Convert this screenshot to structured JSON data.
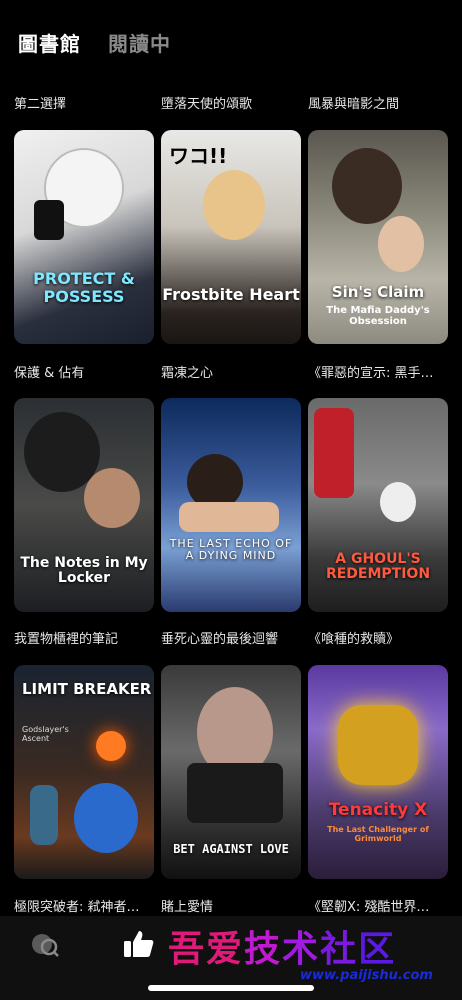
{
  "tabs": {
    "library": "圖書館",
    "reading": "閱讀中"
  },
  "row_labels": [
    "第二選擇",
    "墮落天使的頌歌",
    "風暴與暗影之間"
  ],
  "books": [
    {
      "cover_title": "PROTECT & POSSESS",
      "cover_sub": "",
      "caption": "保護 & 佔有"
    },
    {
      "cover_title": "Frostbite Heart",
      "cover_sub": "",
      "caption": "霜凍之心"
    },
    {
      "cover_title": "Sin's Claim",
      "cover_sub": "The Mafia Daddy's Obsession",
      "caption": "《罪惡的宣示: 黑手…"
    },
    {
      "cover_title": "The Notes in My Locker",
      "cover_sub": "",
      "caption": "我置物櫃裡的筆記"
    },
    {
      "cover_title": "THE LAST ECHO OF A DYING MIND",
      "cover_sub": "",
      "caption": "垂死心靈的最後迴響"
    },
    {
      "cover_title": "A GHOUL'S REDEMPTION",
      "cover_sub": "",
      "caption": "《喰種的救贖》"
    },
    {
      "cover_title": "LIMIT BREAKER",
      "cover_sub": "Godslayer's Ascent",
      "caption": "極限突破者: 弒神者…"
    },
    {
      "cover_title": "BET AGAINST LOVE",
      "cover_sub": "",
      "caption": "賭上愛情"
    },
    {
      "cover_title": "Tenacity X",
      "cover_sub": "The Last Challenger of Grimworld",
      "caption": "《堅韌X: 殘酷世界…"
    }
  ],
  "watermark": {
    "text": "吾爱技术社区",
    "url": "www.paijishu.com"
  },
  "icons": {
    "tab1": "chat-search-icon",
    "tab2": "thumbs-up-icon"
  }
}
